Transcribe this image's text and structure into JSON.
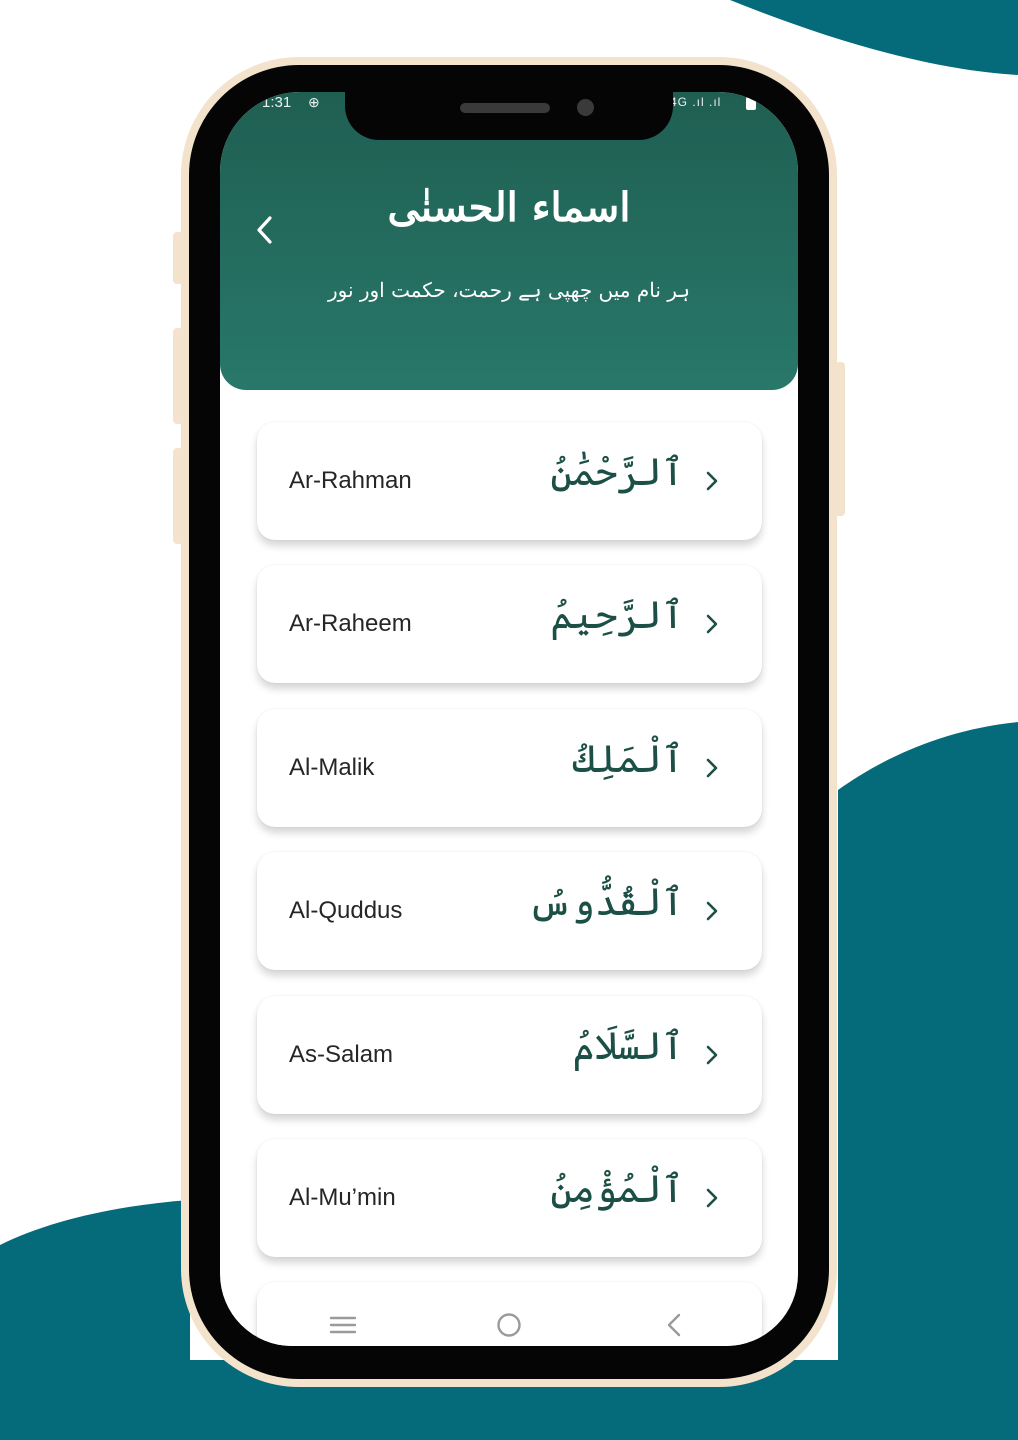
{
  "colors": {
    "backdrop_blob": "#056a79",
    "header_top": "#1f5f52",
    "header_bottom": "#28786a",
    "phone_frame": "#f3e2cc",
    "arabic_text": "#1c4f45"
  },
  "status_bar": {
    "time": "1:31",
    "network": "4G .ıl .ıl"
  },
  "header": {
    "title": "اسماء الحسنٰی",
    "subtitle": "ہر نام میں چھپی ہے رحمت، حکمت اور نور",
    "back_icon": "chevron-left-icon"
  },
  "names": [
    {
      "english": "Ar-Rahman",
      "arabic": "ٱلرَّحْمَٰنُ"
    },
    {
      "english": "Ar-Raheem",
      "arabic": "ٱلرَّحِيمُ"
    },
    {
      "english": "Al-Malik",
      "arabic": "ٱلْمَلِكُ"
    },
    {
      "english": "Al-Quddus",
      "arabic": "ٱلْقُدُّوسُ"
    },
    {
      "english": "As-Salam",
      "arabic": "ٱلسَّلَامُ"
    },
    {
      "english": "Al-Mu’min",
      "arabic": "ٱلْمُؤْمِنُ"
    }
  ],
  "nav_bar": {
    "menu_icon": "menu-icon",
    "home_icon": "circle-home-icon",
    "back_icon": "nav-back-icon"
  }
}
